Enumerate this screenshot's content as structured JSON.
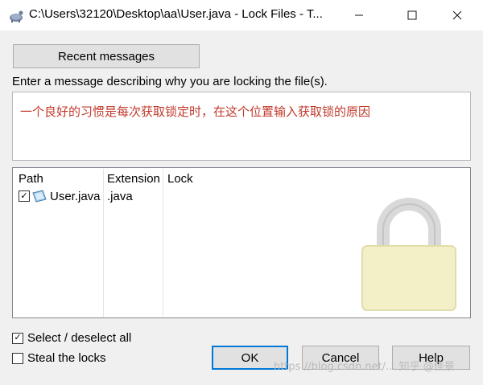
{
  "window": {
    "title": "C:\\Users\\32120\\Desktop\\aa\\User.java - Lock Files - T...",
    "minimize_icon": "minimize-icon",
    "maximize_icon": "maximize-icon",
    "close_icon": "close-icon"
  },
  "recent_button": "Recent messages",
  "prompt": "Enter a message describing why you are locking the file(s).",
  "message_text": "一个良好的习惯是每次获取锁定时，在这个位置输入获取锁的原因",
  "file_list": {
    "columns": [
      "Path",
      "Extension",
      "Lock"
    ],
    "rows": [
      {
        "checked": true,
        "path": "User.java",
        "extension": ".java",
        "lock": ""
      }
    ]
  },
  "options": {
    "select_all": {
      "label": "Select / deselect all",
      "checked": true
    },
    "steal_locks": {
      "label": "Steal the locks",
      "checked": false
    }
  },
  "buttons": {
    "ok": "OK",
    "cancel": "Cancel",
    "help": "Help"
  },
  "watermark": "https://blog.csdn.net/...",
  "watermark_text": "知乎 @佳景",
  "colors": {
    "message_text": "#c0392b",
    "ok_border": "#0078d7"
  }
}
